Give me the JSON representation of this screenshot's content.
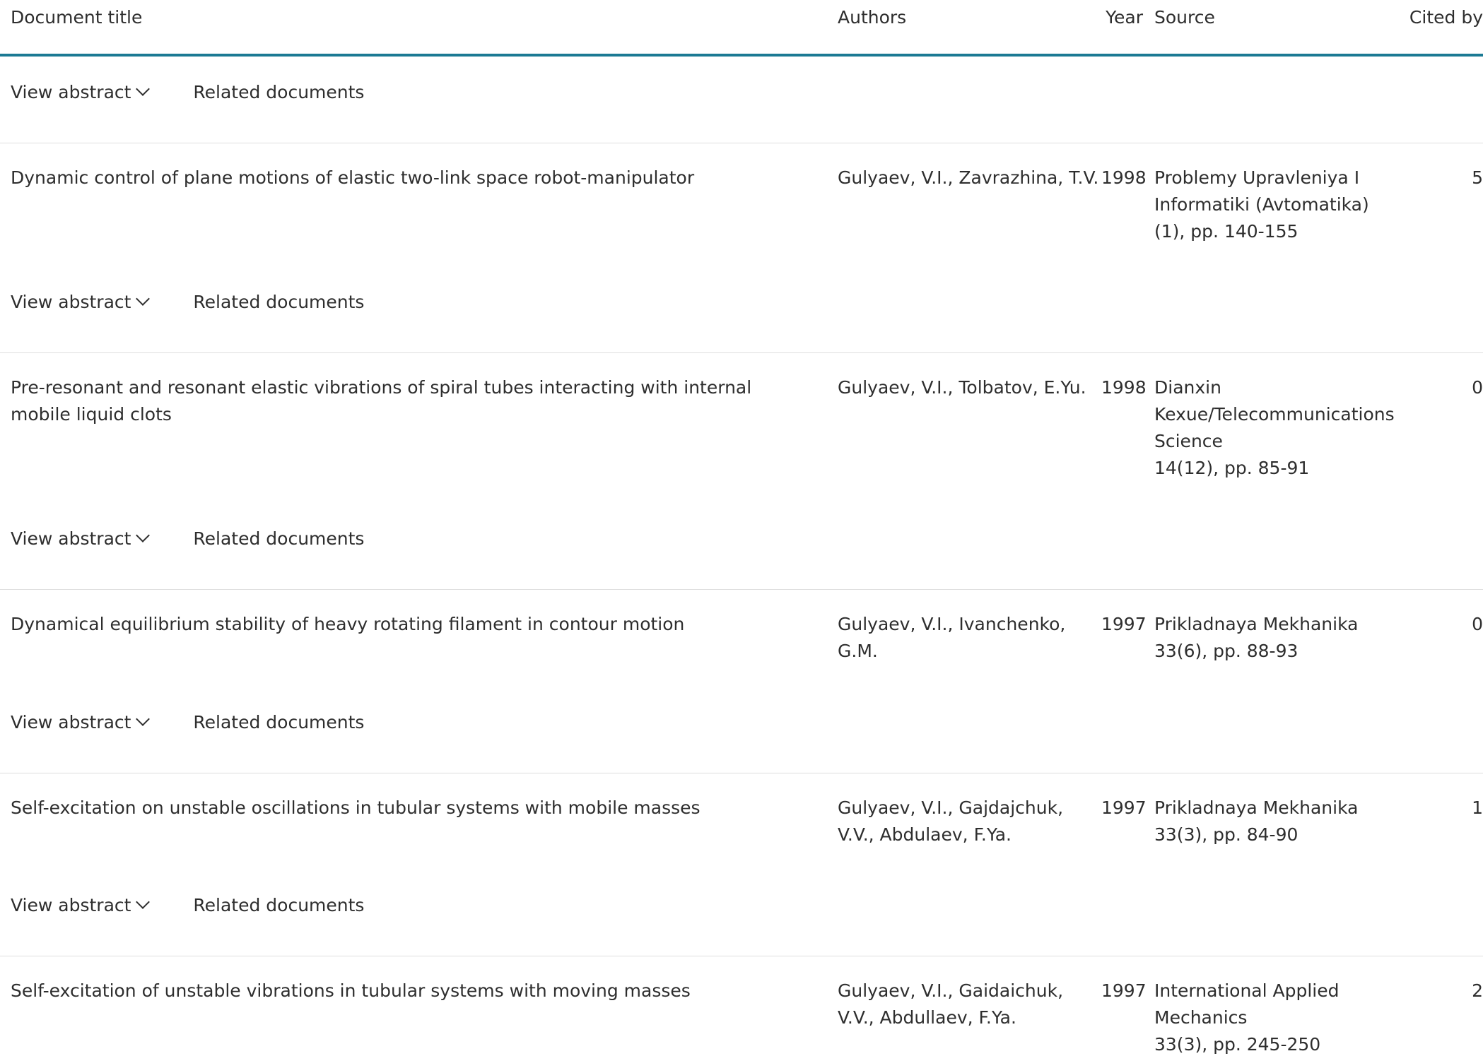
{
  "header": {
    "document_title": "Document title",
    "authors": "Authors",
    "year": "Year",
    "source": "Source",
    "cited_by": "Cited by"
  },
  "actions": {
    "view_abstract": "View abstract",
    "related_documents": "Related documents"
  },
  "documents": [
    {
      "title": "Dynamic control of plane motions of elastic two-link space robot-manipulator",
      "authors": "Gulyaev, V.I., Zavrazhina, T.V.",
      "year": "1998",
      "source_lines": [
        "Problemy Upravleniya I",
        "Informatiki (Avtomatika)",
        "(1), pp. 140-155"
      ],
      "cited_by": "5"
    },
    {
      "title": "Pre-resonant and resonant elastic vibrations of spiral tubes interacting with internal mobile liquid clots",
      "authors": "Gulyaev, V.I., Tolbatov, E.Yu.",
      "year": "1998",
      "source_lines": [
        "Dianxin",
        "Kexue/Telecommunications",
        "Science",
        "14(12), pp. 85-91"
      ],
      "cited_by": "0"
    },
    {
      "title": "Dynamical equilibrium stability of heavy rotating filament in contour motion",
      "authors": "Gulyaev, V.I., Ivanchenko, G.M.",
      "year": "1997",
      "source_lines": [
        "Prikladnaya Mekhanika",
        "33(6), pp. 88-93"
      ],
      "cited_by": "0"
    },
    {
      "title": "Self-excitation on unstable oscillations in tubular systems with mobile masses",
      "authors": "Gulyaev, V.I., Gajdajchuk, V.V., Abdulaev, F.Ya.",
      "year": "1997",
      "source_lines": [
        "Prikladnaya Mekhanika",
        "33(3), pp. 84-90"
      ],
      "cited_by": "1"
    },
    {
      "title": "Self-excitation of unstable vibrations in tubular systems with moving masses",
      "authors": "Gulyaev, V.I., Gaidaichuk, V.V., Abdullaev, F.Ya.",
      "year": "1997",
      "source_lines": [
        "International Applied",
        "Mechanics",
        "33(3), pp. 245-250"
      ],
      "cited_by": "2"
    }
  ]
}
